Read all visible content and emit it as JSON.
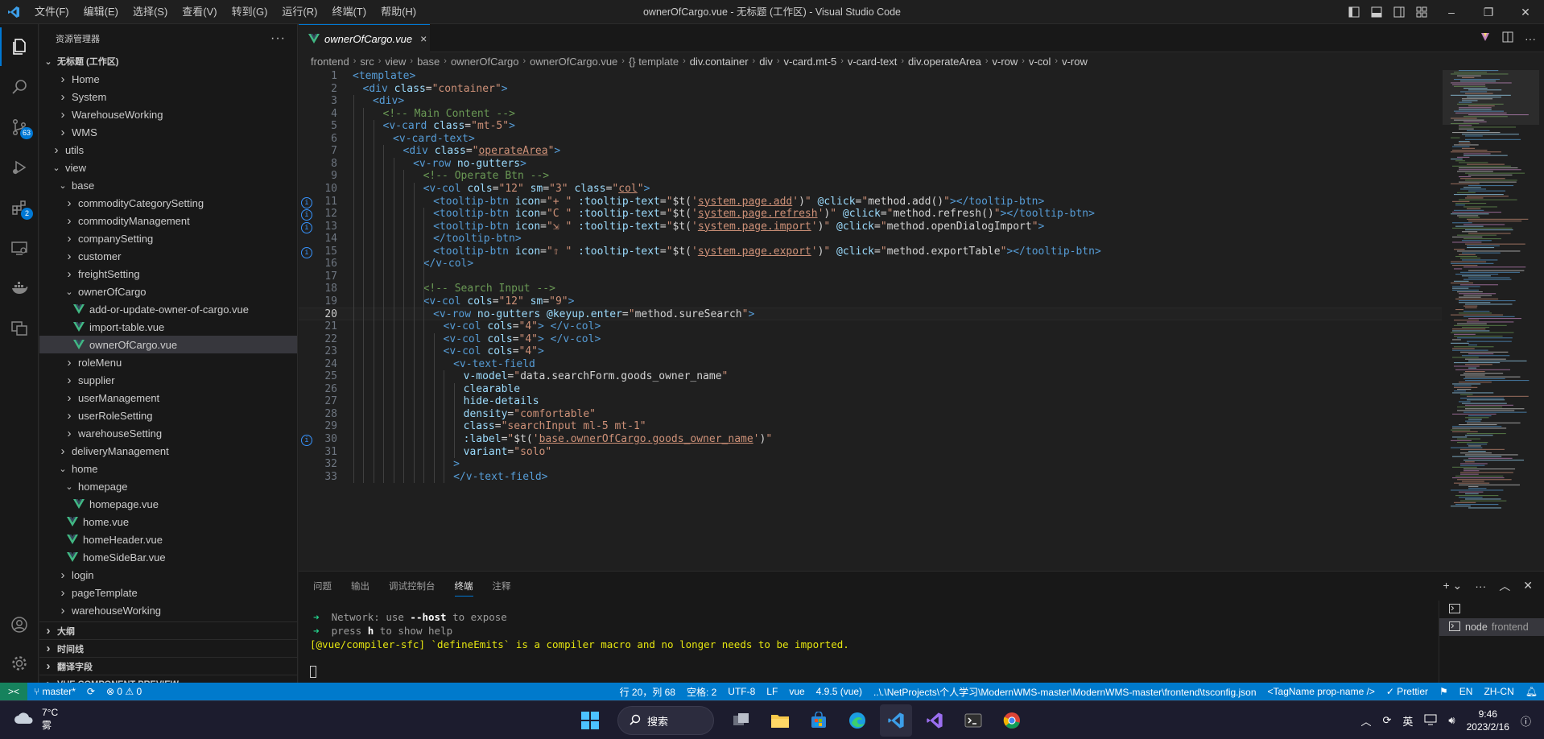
{
  "window": {
    "title": "ownerOfCargo.vue - 无标题 (工作区) - Visual Studio Code",
    "menu": [
      "文件(F)",
      "编辑(E)",
      "选择(S)",
      "查看(V)",
      "转到(G)",
      "运行(R)",
      "终端(T)",
      "帮助(H)"
    ]
  },
  "activity": {
    "scm_badge": "63",
    "ext_badge": "2"
  },
  "sidebar": {
    "header": "资源管理器",
    "more": "···",
    "workspace": "无标题 (工作区)",
    "tree": [
      {
        "label": "Home",
        "indent": 3,
        "kind": "folder-closed"
      },
      {
        "label": "System",
        "indent": 3,
        "kind": "folder-closed"
      },
      {
        "label": "WarehouseWorking",
        "indent": 3,
        "kind": "folder-closed"
      },
      {
        "label": "WMS",
        "indent": 3,
        "kind": "folder-closed"
      },
      {
        "label": "utils",
        "indent": 2,
        "kind": "folder-closed"
      },
      {
        "label": "view",
        "indent": 2,
        "kind": "folder-open"
      },
      {
        "label": "base",
        "indent": 3,
        "kind": "folder-open"
      },
      {
        "label": "commodityCategorySetting",
        "indent": 4,
        "kind": "folder-closed"
      },
      {
        "label": "commodityManagement",
        "indent": 4,
        "kind": "folder-closed"
      },
      {
        "label": "companySetting",
        "indent": 4,
        "kind": "folder-closed"
      },
      {
        "label": "customer",
        "indent": 4,
        "kind": "folder-closed"
      },
      {
        "label": "freightSetting",
        "indent": 4,
        "kind": "folder-closed"
      },
      {
        "label": "ownerOfCargo",
        "indent": 4,
        "kind": "folder-open"
      },
      {
        "label": "add-or-update-owner-of-cargo.vue",
        "indent": 5,
        "kind": "vue"
      },
      {
        "label": "import-table.vue",
        "indent": 5,
        "kind": "vue"
      },
      {
        "label": "ownerOfCargo.vue",
        "indent": 5,
        "kind": "vue",
        "selected": true
      },
      {
        "label": "roleMenu",
        "indent": 4,
        "kind": "folder-closed"
      },
      {
        "label": "supplier",
        "indent": 4,
        "kind": "folder-closed"
      },
      {
        "label": "userManagement",
        "indent": 4,
        "kind": "folder-closed"
      },
      {
        "label": "userRoleSetting",
        "indent": 4,
        "kind": "folder-closed"
      },
      {
        "label": "warehouseSetting",
        "indent": 4,
        "kind": "folder-closed"
      },
      {
        "label": "deliveryManagement",
        "indent": 3,
        "kind": "folder-closed"
      },
      {
        "label": "home",
        "indent": 3,
        "kind": "folder-open"
      },
      {
        "label": "homepage",
        "indent": 4,
        "kind": "folder-open"
      },
      {
        "label": "homepage.vue",
        "indent": 5,
        "kind": "vue"
      },
      {
        "label": "home.vue",
        "indent": 4,
        "kind": "vue"
      },
      {
        "label": "homeHeader.vue",
        "indent": 4,
        "kind": "vue"
      },
      {
        "label": "homeSideBar.vue",
        "indent": 4,
        "kind": "vue"
      },
      {
        "label": "login",
        "indent": 3,
        "kind": "folder-closed"
      },
      {
        "label": "pageTemplate",
        "indent": 3,
        "kind": "folder-closed"
      },
      {
        "label": "warehouseWorking",
        "indent": 3,
        "kind": "folder-closed"
      }
    ],
    "sections": [
      "大纲",
      "时间线",
      "翻译字段",
      "VUE COMPONENT PREVIEW"
    ]
  },
  "tab": {
    "label": "ownerOfCargo.vue",
    "close": "×"
  },
  "breadcrumbs": [
    "frontend",
    "src",
    "view",
    "base",
    "ownerOfCargo",
    "ownerOfCargo.vue",
    "{} template",
    "div.container",
    "div",
    "v-card.mt-5",
    "v-card-text",
    "div.operateArea",
    "v-row",
    "v-col",
    "v-row"
  ],
  "code": [
    {
      "n": "1",
      "ind": 0,
      "t": [
        [
          "tag",
          "<template>"
        ]
      ]
    },
    {
      "n": "2",
      "ind": 1,
      "t": [
        [
          "tag",
          "<div "
        ],
        [
          "attr",
          "class"
        ],
        [
          "txt",
          "="
        ],
        [
          "str",
          "\"container\""
        ],
        [
          "tag",
          ">"
        ]
      ]
    },
    {
      "n": "3",
      "ind": 2,
      "t": [
        [
          "tag",
          "<div>"
        ]
      ]
    },
    {
      "n": "4",
      "ind": 3,
      "t": [
        [
          "com",
          "<!-- Main Content -->"
        ]
      ]
    },
    {
      "n": "5",
      "ind": 3,
      "t": [
        [
          "tag",
          "<v-card "
        ],
        [
          "attr",
          "class"
        ],
        [
          "txt",
          "="
        ],
        [
          "str",
          "\"mt-5\""
        ],
        [
          "tag",
          ">"
        ]
      ]
    },
    {
      "n": "6",
      "ind": 4,
      "t": [
        [
          "tag",
          "<v-card-text>"
        ]
      ]
    },
    {
      "n": "7",
      "ind": 5,
      "t": [
        [
          "tag",
          "<div "
        ],
        [
          "attr",
          "class"
        ],
        [
          "txt",
          "="
        ],
        [
          "str",
          "\""
        ],
        [
          "strul",
          "operateArea"
        ],
        [
          "str",
          "\""
        ],
        [
          "tag",
          ">"
        ]
      ]
    },
    {
      "n": "8",
      "ind": 6,
      "t": [
        [
          "tag",
          "<v-row "
        ],
        [
          "attr",
          "no-gutters"
        ],
        [
          "tag",
          ">"
        ]
      ]
    },
    {
      "n": "9",
      "ind": 7,
      "t": [
        [
          "com",
          "<!-- Operate Btn -->"
        ]
      ]
    },
    {
      "n": "10",
      "ind": 7,
      "t": [
        [
          "tag",
          "<v-col "
        ],
        [
          "attr",
          "cols"
        ],
        [
          "txt",
          "="
        ],
        [
          "str",
          "\"12\""
        ],
        [
          "attr",
          " sm"
        ],
        [
          "txt",
          "="
        ],
        [
          "str",
          "\"3\""
        ],
        [
          "attr",
          " class"
        ],
        [
          "txt",
          "="
        ],
        [
          "str",
          "\""
        ],
        [
          "strul",
          "col"
        ],
        [
          "str",
          "\""
        ],
        [
          "tag",
          ">"
        ]
      ]
    },
    {
      "n": "11",
      "ind": 8,
      "info": true,
      "t": [
        [
          "tag",
          "<tooltip-btn "
        ],
        [
          "attr",
          "icon"
        ],
        [
          "txt",
          "="
        ],
        [
          "str",
          "\"+ \""
        ],
        [
          "attr",
          " :tooltip-text"
        ],
        [
          "txt",
          "="
        ],
        [
          "str",
          "\""
        ],
        [
          "txt",
          "$t("
        ],
        [
          "str",
          "'"
        ],
        [
          "strul",
          "system.page.add"
        ],
        [
          "str",
          "'"
        ],
        [
          "txt",
          ")"
        ],
        [
          "str",
          "\""
        ],
        [
          "attr",
          " @click"
        ],
        [
          "txt",
          "="
        ],
        [
          "str",
          "\""
        ],
        [
          "txt",
          "method.add()"
        ],
        [
          "str",
          "\""
        ],
        [
          "tag",
          "></tooltip-btn>"
        ]
      ]
    },
    {
      "n": "12",
      "ind": 8,
      "info": true,
      "t": [
        [
          "tag",
          "<tooltip-btn "
        ],
        [
          "attr",
          "icon"
        ],
        [
          "txt",
          "="
        ],
        [
          "str",
          "\"C \""
        ],
        [
          "attr",
          " :tooltip-text"
        ],
        [
          "txt",
          "="
        ],
        [
          "str",
          "\""
        ],
        [
          "txt",
          "$t("
        ],
        [
          "str",
          "'"
        ],
        [
          "strul",
          "system.page.refresh"
        ],
        [
          "str",
          "'"
        ],
        [
          "txt",
          ")"
        ],
        [
          "str",
          "\""
        ],
        [
          "attr",
          " @click"
        ],
        [
          "txt",
          "="
        ],
        [
          "str",
          "\""
        ],
        [
          "txt",
          "method.refresh()"
        ],
        [
          "str",
          "\""
        ],
        [
          "tag",
          "></tooltip-btn>"
        ]
      ]
    },
    {
      "n": "13",
      "ind": 8,
      "info": true,
      "t": [
        [
          "tag",
          "<tooltip-btn "
        ],
        [
          "attr",
          "icon"
        ],
        [
          "txt",
          "="
        ],
        [
          "str",
          "\"⇲ \""
        ],
        [
          "attr",
          " :tooltip-text"
        ],
        [
          "txt",
          "="
        ],
        [
          "str",
          "\""
        ],
        [
          "txt",
          "$t("
        ],
        [
          "str",
          "'"
        ],
        [
          "strul",
          "system.page.import"
        ],
        [
          "str",
          "'"
        ],
        [
          "txt",
          ")"
        ],
        [
          "str",
          "\""
        ],
        [
          "attr",
          " @click"
        ],
        [
          "txt",
          "="
        ],
        [
          "str",
          "\""
        ],
        [
          "txt",
          "method.openDialogImport"
        ],
        [
          "str",
          "\""
        ],
        [
          "tag",
          ">"
        ]
      ]
    },
    {
      "n": "14",
      "ind": 8,
      "t": [
        [
          "tag",
          "</tooltip-btn>"
        ]
      ]
    },
    {
      "n": "15",
      "ind": 8,
      "info": true,
      "t": [
        [
          "tag",
          "<tooltip-btn "
        ],
        [
          "attr",
          "icon"
        ],
        [
          "txt",
          "="
        ],
        [
          "str",
          "\"⇧ \""
        ],
        [
          "attr",
          " :tooltip-text"
        ],
        [
          "txt",
          "="
        ],
        [
          "str",
          "\""
        ],
        [
          "txt",
          "$t("
        ],
        [
          "str",
          "'"
        ],
        [
          "strul",
          "system.page.export"
        ],
        [
          "str",
          "'"
        ],
        [
          "txt",
          ")"
        ],
        [
          "str",
          "\""
        ],
        [
          "attr",
          " @click"
        ],
        [
          "txt",
          "="
        ],
        [
          "str",
          "\""
        ],
        [
          "txt",
          "method.exportTable"
        ],
        [
          "str",
          "\""
        ],
        [
          "tag",
          "></tooltip-btn>"
        ]
      ]
    },
    {
      "n": "16",
      "ind": 7,
      "t": [
        [
          "tag",
          "</v-col>"
        ]
      ]
    },
    {
      "n": "17",
      "ind": 0,
      "t": []
    },
    {
      "n": "18",
      "ind": 7,
      "t": [
        [
          "com",
          "<!-- Search Input -->"
        ]
      ]
    },
    {
      "n": "19",
      "ind": 7,
      "t": [
        [
          "tag",
          "<v-col "
        ],
        [
          "attr",
          "cols"
        ],
        [
          "txt",
          "="
        ],
        [
          "str",
          "\"12\""
        ],
        [
          "attr",
          " sm"
        ],
        [
          "txt",
          "="
        ],
        [
          "str",
          "\"9\""
        ],
        [
          "tag",
          ">"
        ]
      ]
    },
    {
      "n": "20",
      "ind": 8,
      "cur": true,
      "t": [
        [
          "tag",
          "<v-row "
        ],
        [
          "attr",
          "no-gutters"
        ],
        [
          "attr",
          " @keyup.enter"
        ],
        [
          "txt",
          "="
        ],
        [
          "str",
          "\""
        ],
        [
          "txt",
          "method.sureSearch"
        ],
        [
          "str",
          "\""
        ],
        [
          "tag",
          ">"
        ]
      ]
    },
    {
      "n": "21",
      "ind": 9,
      "t": [
        [
          "tag",
          "<v-col "
        ],
        [
          "attr",
          "cols"
        ],
        [
          "txt",
          "="
        ],
        [
          "str",
          "\"4\""
        ],
        [
          "tag",
          "> </v-col>"
        ]
      ]
    },
    {
      "n": "22",
      "ind": 9,
      "t": [
        [
          "tag",
          "<v-col "
        ],
        [
          "attr",
          "cols"
        ],
        [
          "txt",
          "="
        ],
        [
          "str",
          "\"4\""
        ],
        [
          "tag",
          "> </v-col>"
        ]
      ]
    },
    {
      "n": "23",
      "ind": 9,
      "t": [
        [
          "tag",
          "<v-col "
        ],
        [
          "attr",
          "cols"
        ],
        [
          "txt",
          "="
        ],
        [
          "str",
          "\"4\""
        ],
        [
          "tag",
          ">"
        ]
      ]
    },
    {
      "n": "24",
      "ind": 10,
      "t": [
        [
          "tag",
          "<v-text-field"
        ]
      ]
    },
    {
      "n": "25",
      "ind": 11,
      "t": [
        [
          "attr",
          "v-model"
        ],
        [
          "txt",
          "="
        ],
        [
          "str",
          "\""
        ],
        [
          "txt",
          "data.searchForm.goods_owner_name"
        ],
        [
          "str",
          "\""
        ]
      ]
    },
    {
      "n": "26",
      "ind": 11,
      "t": [
        [
          "attr",
          "clearable"
        ]
      ]
    },
    {
      "n": "27",
      "ind": 11,
      "t": [
        [
          "attr",
          "hide-details"
        ]
      ]
    },
    {
      "n": "28",
      "ind": 11,
      "t": [
        [
          "attr",
          "density"
        ],
        [
          "txt",
          "="
        ],
        [
          "str",
          "\"comfortable\""
        ]
      ]
    },
    {
      "n": "29",
      "ind": 11,
      "t": [
        [
          "attr",
          "class"
        ],
        [
          "txt",
          "="
        ],
        [
          "str",
          "\"searchInput ml-5 mt-1\""
        ]
      ]
    },
    {
      "n": "30",
      "ind": 11,
      "info": true,
      "t": [
        [
          "attr",
          ":label"
        ],
        [
          "txt",
          "="
        ],
        [
          "str",
          "\""
        ],
        [
          "txt",
          "$t("
        ],
        [
          "str",
          "'"
        ],
        [
          "strul",
          "base.ownerOfCargo.goods_owner_name"
        ],
        [
          "str",
          "'"
        ],
        [
          "txt",
          ")"
        ],
        [
          "str",
          "\""
        ]
      ]
    },
    {
      "n": "31",
      "ind": 11,
      "t": [
        [
          "attr",
          "variant"
        ],
        [
          "txt",
          "="
        ],
        [
          "str",
          "\"solo\""
        ]
      ]
    },
    {
      "n": "32",
      "ind": 10,
      "t": [
        [
          "tag",
          ">"
        ]
      ]
    },
    {
      "n": "33",
      "ind": 10,
      "t": [
        [
          "tag",
          "</v-text-field>"
        ]
      ]
    }
  ],
  "panel": {
    "tabs": [
      "问题",
      "输出",
      "调试控制台",
      "终端",
      "注释"
    ],
    "active_tab": "终端",
    "terminal_lines": [
      {
        "arrow": "➜",
        "pre": "  Network: use ",
        "bold": "--host",
        "post": " to expose"
      },
      {
        "arrow": "➜",
        "pre": "  press ",
        "bold": "h",
        "post": " to show help"
      }
    ],
    "warning": "[@vue/compiler-sfc] `defineEmits` is a compiler macro and no longer needs to be imported.",
    "terminal_item_node": "node",
    "terminal_item_cwd": "frontend"
  },
  "status": {
    "branch": "master*",
    "problems": "⊗ 0 ⚠ 0",
    "items_right": [
      "行 20，列 68",
      "空格: 2",
      "UTF-8",
      "LF",
      "vue",
      "4.9.5 (vue)",
      "..\\.\\NetProjects\\个人学习\\ModernWMS-master\\ModernWMS-master\\frontend\\tsconfig.json",
      "<TagName prop-name />",
      "✓ Prettier",
      "EN",
      "ZH-CN"
    ]
  },
  "taskbar": {
    "temp": "7°C",
    "weather": "雾",
    "search": "搜索",
    "ime": "英",
    "time": "9:46",
    "date": "2023/2/16"
  }
}
